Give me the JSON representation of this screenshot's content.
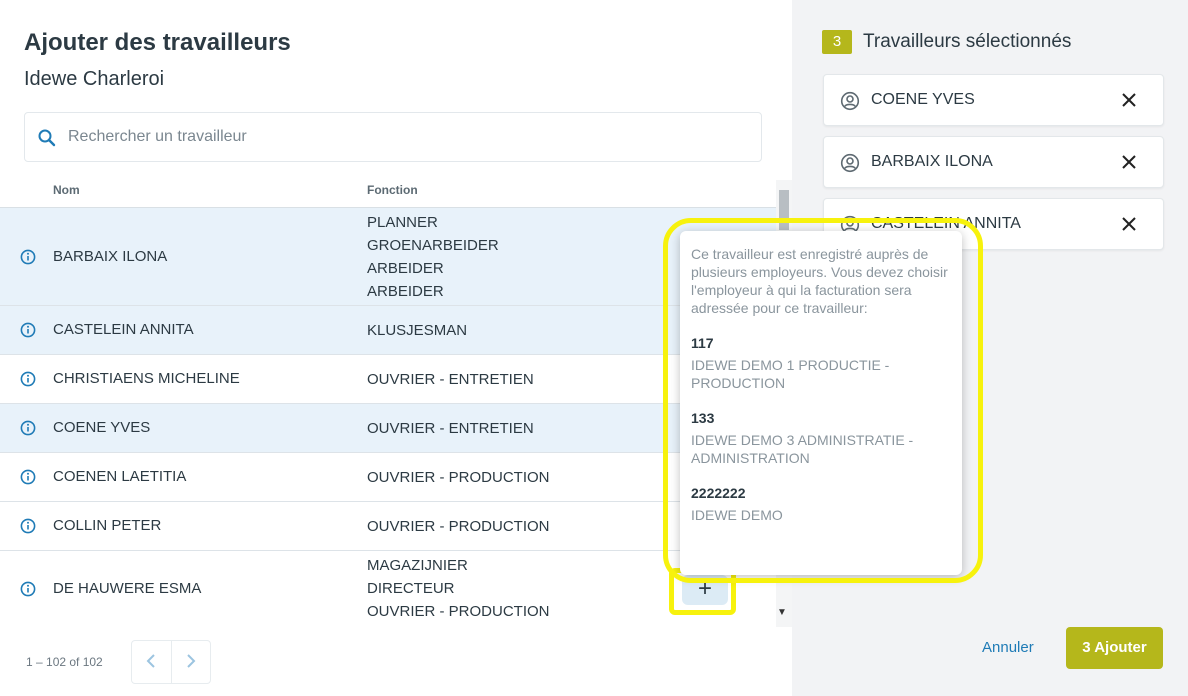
{
  "header": {
    "title": "Ajouter des travailleurs",
    "subtitle": "Idewe Charleroi"
  },
  "search": {
    "placeholder": "Rechercher un travailleur"
  },
  "table": {
    "columns": {
      "name": "Nom",
      "function": "Fonction"
    },
    "rows": [
      {
        "name": "BARBAIX ILONA",
        "functions": [
          "PLANNER",
          "GROENARBEIDER",
          "ARBEIDER",
          "ARBEIDER"
        ],
        "selected": true
      },
      {
        "name": "CASTELEIN ANNITA",
        "functions": [
          "KLUSJESMAN"
        ],
        "selected": true
      },
      {
        "name": "CHRISTIAENS MICHELINE",
        "functions": [
          "OUVRIER - ENTRETIEN"
        ],
        "selected": false
      },
      {
        "name": "COENE YVES",
        "functions": [
          "OUVRIER - ENTRETIEN"
        ],
        "selected": true
      },
      {
        "name": "COENEN LAETITIA",
        "functions": [
          "OUVRIER - PRODUCTION"
        ],
        "selected": false
      },
      {
        "name": "COLLIN PETER",
        "functions": [
          "OUVRIER - PRODUCTION"
        ],
        "selected": false
      },
      {
        "name": "DE HAUWERE ESMA",
        "functions": [
          "MAGAZIJNIER",
          "DIRECTEUR",
          "OUVRIER - PRODUCTION"
        ],
        "selected": false
      }
    ],
    "add_button": "+"
  },
  "pagination": {
    "range": "1 – 102 of 102"
  },
  "tooltip": {
    "message": "Ce travailleur est enregistré auprès de plusieurs employeurs. Vous devez choisir l'employeur à qui la facturation sera adressée pour ce travailleur:",
    "employers": [
      {
        "code": "117",
        "name": "IDEWE DEMO 1 PRODUCTIE - PRODUCTION"
      },
      {
        "code": "133",
        "name": "IDEWE DEMO 3 ADMINISTRATIE - ADMINISTRATION"
      },
      {
        "code": "2222222",
        "name": "IDEWE DEMO"
      }
    ]
  },
  "selected_panel": {
    "count": "3",
    "title": "Travailleurs sélectionnés",
    "items": [
      "COENE YVES",
      "BARBAIX ILONA",
      "CASTELEIN ANNITA"
    ]
  },
  "actions": {
    "cancel": "Annuler",
    "submit": "3 Ajouter"
  },
  "colors": {
    "accent": "#b5b71b",
    "link": "#1f7bb6",
    "highlight": "#f7f20d",
    "selected_row": "#e8f2fa"
  }
}
